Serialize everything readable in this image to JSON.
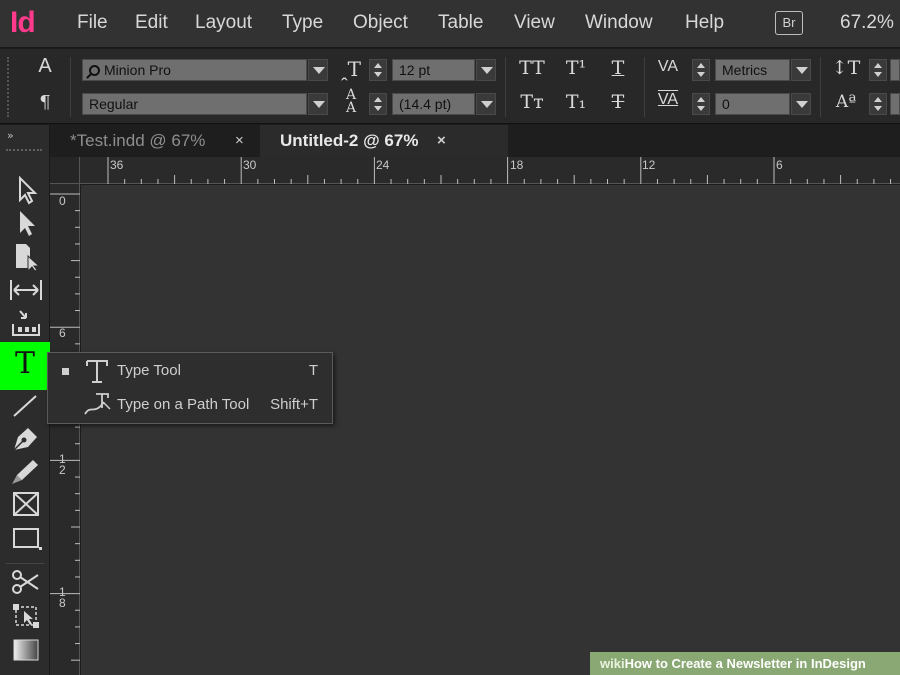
{
  "app": {
    "logo": "Id"
  },
  "menu": [
    "File",
    "Edit",
    "Layout",
    "Type",
    "Object",
    "Table",
    "View",
    "Window",
    "Help"
  ],
  "bridge_badge": "Br",
  "zoom": "67.2%",
  "control_panel": {
    "char_glyph": "A",
    "para_glyph": "¶",
    "font_family": "Minion Pro",
    "font_style": "Regular",
    "font_size": "12 pt",
    "leading": "(14.4 pt)",
    "kerning": "Metrics",
    "tracking": "0",
    "all_caps": "TT",
    "superscript": "T¹",
    "underline": "T",
    "small_caps": "Tт",
    "subscript": "T₁",
    "strikethrough": "T",
    "kerning_glyph": "VA",
    "tracking_glyph": "VA",
    "vscale_glyph": "↕T",
    "baseline_glyph": "Aª"
  },
  "tabs": [
    {
      "label": "*Test.indd @ 67%",
      "close": "×"
    },
    {
      "label": "Untitled-2 @ 67%",
      "close": "×"
    }
  ],
  "toolbox": {
    "expand": "»",
    "type_tool_glyph": "T"
  },
  "ruler_h": [
    "36",
    "30",
    "24",
    "18",
    "12",
    "6"
  ],
  "ruler_v": [
    "0",
    "6",
    "1\n2",
    "1\n8"
  ],
  "flyout": [
    {
      "label": "Type Tool",
      "shortcut": "T"
    },
    {
      "label": "Type on a Path Tool",
      "shortcut": "Shift+T"
    }
  ],
  "watermark": {
    "prefix": "wiki",
    "how": "How",
    "text": " to Create a Newsletter in InDesign"
  },
  "colors": {
    "logo": "#ff3a8c",
    "highlight": "#00ff00",
    "watermark": "#8aa873"
  }
}
